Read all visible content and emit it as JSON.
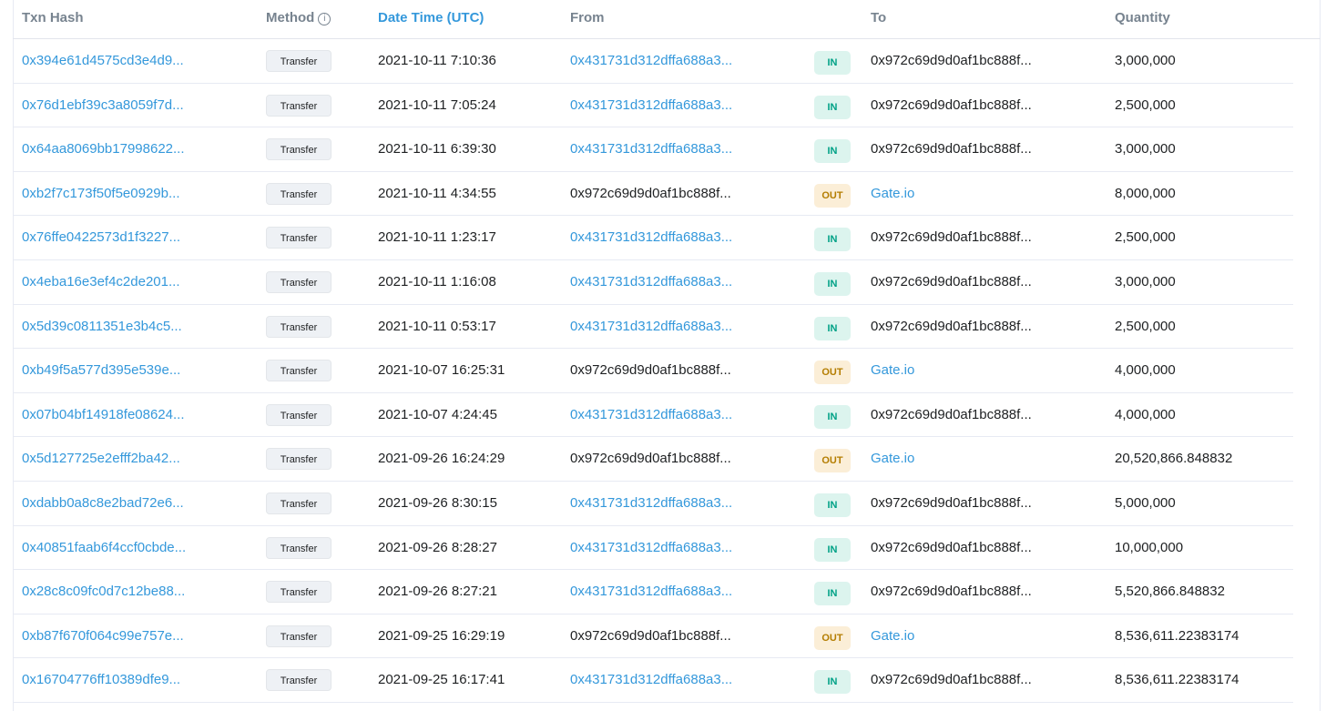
{
  "headers": {
    "txn_hash": "Txn Hash",
    "method": "Method",
    "method_info_icon": "info-icon",
    "date_time": "Date Time (UTC)",
    "from": "From",
    "to": "To",
    "quantity": "Quantity"
  },
  "colors": {
    "link": "#3498db",
    "in_badge_bg": "#dcf4ee",
    "in_badge_text": "#00a186",
    "out_badge_bg": "#fbeed7",
    "out_badge_text": "#b47d00"
  },
  "rows": [
    {
      "hash": "0x394e61d4575cd3e4d9...",
      "method": "Transfer",
      "date": "2021-10-11 7:10:36",
      "from": "0x431731d312dffa688a3...",
      "from_link": true,
      "dir": "IN",
      "to": "0x972c69d9d0af1bc888f...",
      "to_link": false,
      "qty": "3,000,000"
    },
    {
      "hash": "0x76d1ebf39c3a8059f7d...",
      "method": "Transfer",
      "date": "2021-10-11 7:05:24",
      "from": "0x431731d312dffa688a3...",
      "from_link": true,
      "dir": "IN",
      "to": "0x972c69d9d0af1bc888f...",
      "to_link": false,
      "qty": "2,500,000"
    },
    {
      "hash": "0x64aa8069bb17998622...",
      "method": "Transfer",
      "date": "2021-10-11 6:39:30",
      "from": "0x431731d312dffa688a3...",
      "from_link": true,
      "dir": "IN",
      "to": "0x972c69d9d0af1bc888f...",
      "to_link": false,
      "qty": "3,000,000"
    },
    {
      "hash": "0xb2f7c173f50f5e0929b...",
      "method": "Transfer",
      "date": "2021-10-11 4:34:55",
      "from": "0x972c69d9d0af1bc888f...",
      "from_link": false,
      "dir": "OUT",
      "to": "Gate.io",
      "to_link": true,
      "qty": "8,000,000"
    },
    {
      "hash": "0x76ffe0422573d1f3227...",
      "method": "Transfer",
      "date": "2021-10-11 1:23:17",
      "from": "0x431731d312dffa688a3...",
      "from_link": true,
      "dir": "IN",
      "to": "0x972c69d9d0af1bc888f...",
      "to_link": false,
      "qty": "2,500,000"
    },
    {
      "hash": "0x4eba16e3ef4c2de201...",
      "method": "Transfer",
      "date": "2021-10-11 1:16:08",
      "from": "0x431731d312dffa688a3...",
      "from_link": true,
      "dir": "IN",
      "to": "0x972c69d9d0af1bc888f...",
      "to_link": false,
      "qty": "3,000,000"
    },
    {
      "hash": "0x5d39c0811351e3b4c5...",
      "method": "Transfer",
      "date": "2021-10-11 0:53:17",
      "from": "0x431731d312dffa688a3...",
      "from_link": true,
      "dir": "IN",
      "to": "0x972c69d9d0af1bc888f...",
      "to_link": false,
      "qty": "2,500,000"
    },
    {
      "hash": "0xb49f5a577d395e539e...",
      "method": "Transfer",
      "date": "2021-10-07 16:25:31",
      "from": "0x972c69d9d0af1bc888f...",
      "from_link": false,
      "dir": "OUT",
      "to": "Gate.io",
      "to_link": true,
      "qty": "4,000,000"
    },
    {
      "hash": "0x07b04bf14918fe08624...",
      "method": "Transfer",
      "date": "2021-10-07 4:24:45",
      "from": "0x431731d312dffa688a3...",
      "from_link": true,
      "dir": "IN",
      "to": "0x972c69d9d0af1bc888f...",
      "to_link": false,
      "qty": "4,000,000"
    },
    {
      "hash": "0x5d127725e2efff2ba42...",
      "method": "Transfer",
      "date": "2021-09-26 16:24:29",
      "from": "0x972c69d9d0af1bc888f...",
      "from_link": false,
      "dir": "OUT",
      "to": "Gate.io",
      "to_link": true,
      "qty": "20,520,866.848832"
    },
    {
      "hash": "0xdabb0a8c8e2bad72e6...",
      "method": "Transfer",
      "date": "2021-09-26 8:30:15",
      "from": "0x431731d312dffa688a3...",
      "from_link": true,
      "dir": "IN",
      "to": "0x972c69d9d0af1bc888f...",
      "to_link": false,
      "qty": "5,000,000"
    },
    {
      "hash": "0x40851faab6f4ccf0cbde...",
      "method": "Transfer",
      "date": "2021-09-26 8:28:27",
      "from": "0x431731d312dffa688a3...",
      "from_link": true,
      "dir": "IN",
      "to": "0x972c69d9d0af1bc888f...",
      "to_link": false,
      "qty": "10,000,000"
    },
    {
      "hash": "0x28c8c09fc0d7c12be88...",
      "method": "Transfer",
      "date": "2021-09-26 8:27:21",
      "from": "0x431731d312dffa688a3...",
      "from_link": true,
      "dir": "IN",
      "to": "0x972c69d9d0af1bc888f...",
      "to_link": false,
      "qty": "5,520,866.848832"
    },
    {
      "hash": "0xb87f670f064c99e757e...",
      "method": "Transfer",
      "date": "2021-09-25 16:29:19",
      "from": "0x972c69d9d0af1bc888f...",
      "from_link": false,
      "dir": "OUT",
      "to": "Gate.io",
      "to_link": true,
      "qty": "8,536,611.22383174"
    },
    {
      "hash": "0x16704776ff10389dfe9...",
      "method": "Transfer",
      "date": "2021-09-25 16:17:41",
      "from": "0x431731d312dffa688a3...",
      "from_link": true,
      "dir": "IN",
      "to": "0x972c69d9d0af1bc888f...",
      "to_link": false,
      "qty": "8,536,611.22383174"
    }
  ]
}
